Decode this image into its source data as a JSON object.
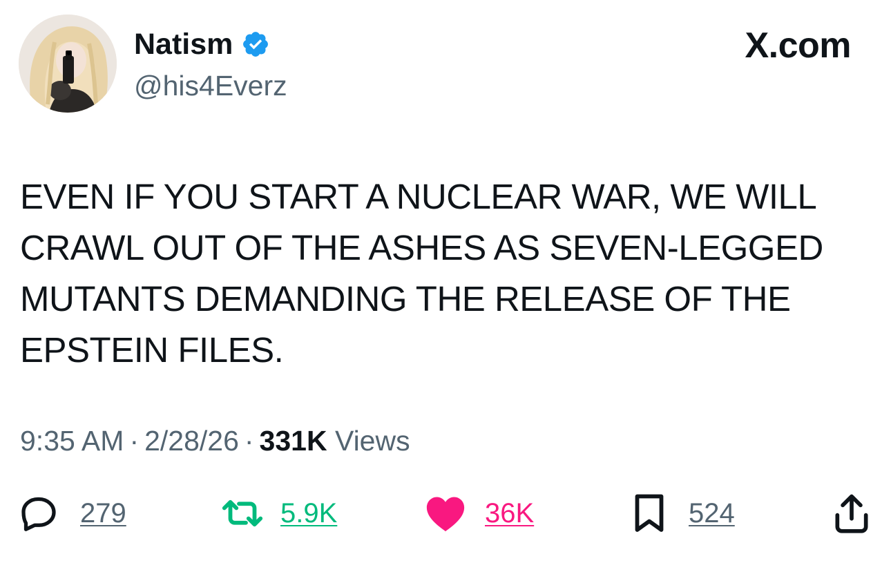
{
  "header": {
    "display_name": "Natism",
    "handle": "@his4Everz",
    "site_logo": "X.com",
    "verified": true
  },
  "tweet": {
    "text": "EVEN IF YOU START A NUCLEAR WAR, WE WILL CRAWL OUT OF THE ASHES AS SEVEN-LEGGED MUTANTS DEMANDING THE RELEASE OF THE EPSTEIN FILES."
  },
  "meta": {
    "time": "9:35 AM",
    "separator": "·",
    "date": "2/28/26",
    "views_count": "331K",
    "views_label": "Views"
  },
  "actions": {
    "replies": "279",
    "reposts": "5.9K",
    "likes": "36K",
    "bookmarks": "524"
  },
  "colors": {
    "text": "#0f1419",
    "secondary": "#536471",
    "verified": "#1d9bf0",
    "repost": "#00ba7c",
    "like": "#f91880"
  },
  "icons": [
    "avatar-image",
    "verified-badge-icon",
    "reply-icon",
    "repost-icon",
    "heart-icon",
    "bookmark-icon",
    "share-icon"
  ]
}
